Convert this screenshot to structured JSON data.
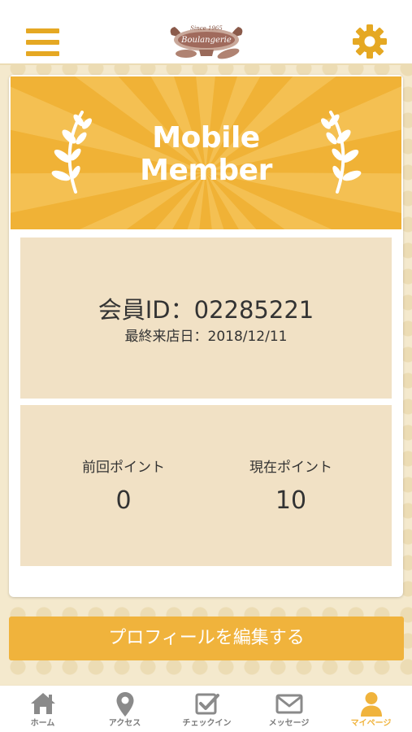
{
  "colors": {
    "accent": "#f0b33c",
    "banner": "#f0b236",
    "panel": "#f1e1c5",
    "background": "#f4e9cd",
    "tab_inactive": "#7a7a7a"
  },
  "header": {
    "menu_icon": "hamburger-menu-icon",
    "logo_text_top": "Since 1965",
    "logo_text_main": "Boulangerie",
    "settings_icon": "gear-icon"
  },
  "card": {
    "banner_title_line1": "Mobile",
    "banner_title_line2": "Member",
    "member_id": "会員ID：02285221",
    "last_visit": "最終来店日：2018/12/11",
    "previous_points_label": "前回ポイント",
    "previous_points_value": "0",
    "current_points_label": "現在ポイント",
    "current_points_value": "10"
  },
  "edit_profile_label": "プロフィールを編集する",
  "tabs": [
    {
      "label": "ホーム",
      "icon": "home-icon",
      "active": false
    },
    {
      "label": "アクセス",
      "icon": "map-pin-icon",
      "active": false
    },
    {
      "label": "チェックイン",
      "icon": "checkin-icon",
      "active": false
    },
    {
      "label": "メッセージ",
      "icon": "envelope-icon",
      "active": false
    },
    {
      "label": "マイページ",
      "icon": "user-icon",
      "active": true
    }
  ]
}
